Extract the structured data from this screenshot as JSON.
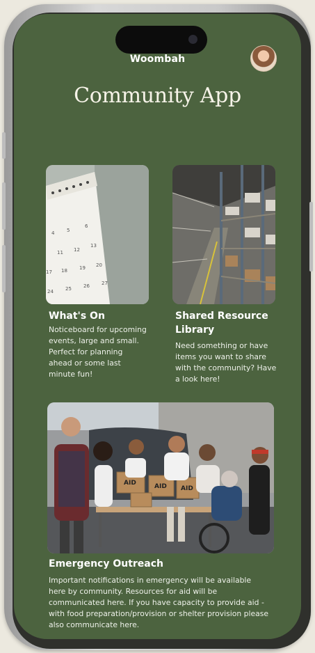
{
  "app": {
    "brand": "Woombah",
    "title": "Community App"
  },
  "cards": {
    "whats_on": {
      "heading": "What's On",
      "description": "Noticeboard for upcoming events, large and small. Perfect for planning ahead or some last minute fun!",
      "image_icon": "calendar-photo"
    },
    "shared_library": {
      "heading": "Shared Resource Library",
      "description": "Need something or have items you want to share with the community? Have a look here!",
      "image_icon": "warehouse-shelves-photo"
    },
    "emergency": {
      "heading": "Emergency Outreach",
      "description": "Important notifications in emergency will be available here by community. Resources for aid will be communicated here. If you have capacity to provide aid - with food preparation/provision or shelter provision please also communicate here.",
      "image_icon": "volunteers-packing-aid-photo",
      "box_labels": [
        "AID",
        "AID",
        "AID"
      ]
    }
  },
  "colors": {
    "screen_bg": "#4c633f",
    "text": "#ffffff",
    "frame": "#2f302c"
  }
}
